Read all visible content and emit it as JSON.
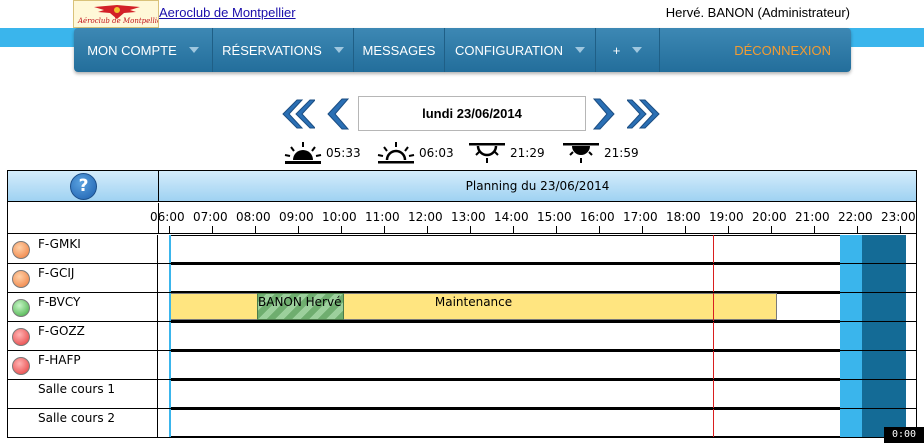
{
  "header": {
    "logo_text": "Aéroclub de Montpellier",
    "club_name": "Aeroclub de Montpellier",
    "user": "Hervé. BANON (Administrateur)"
  },
  "nav": {
    "items": [
      {
        "label": "MON COMPTE",
        "has_caret": true
      },
      {
        "label": "RÉSERVATIONS",
        "has_caret": true
      },
      {
        "label": "MESSAGES",
        "has_caret": false
      },
      {
        "label": "CONFIGURATION",
        "has_caret": true
      },
      {
        "label": "+",
        "has_caret": true
      }
    ],
    "logout": "DÉCONNEXION"
  },
  "date_nav": {
    "current_date": "lundi 23/06/2014",
    "first_icon": "double-chevron-left-icon",
    "prev_icon": "chevron-left-icon",
    "next_icon": "chevron-right-icon",
    "last_icon": "double-chevron-right-icon"
  },
  "sun": {
    "dawn": "05:33",
    "sunrise": "06:03",
    "sunset": "21:29",
    "dusk": "21:59"
  },
  "planning": {
    "help_icon": "help-icon",
    "title": "Planning du 23/06/2014",
    "hours": [
      "06:00",
      "07:00",
      "08:00",
      "09:00",
      "10:00",
      "11:00",
      "12:00",
      "13:00",
      "14:00",
      "15:00",
      "16:00",
      "17:00",
      "18:00",
      "19:00",
      "20:00",
      "21:00",
      "22:00",
      "23:00"
    ],
    "resources": [
      {
        "name": "F-GMKI",
        "status": "orange"
      },
      {
        "name": "F-GCIJ",
        "status": "orange"
      },
      {
        "name": "F-BVCY",
        "status": "green"
      },
      {
        "name": "F-GOZZ",
        "status": "red"
      },
      {
        "name": "F-HAFP",
        "status": "red"
      },
      {
        "name": "Salle cours 1",
        "status": null
      },
      {
        "name": "Salle cours 2",
        "status": null
      }
    ],
    "bookings": {
      "pilot": "BANON Hervé",
      "maintenance": "Maintenance"
    }
  },
  "colors": {
    "top_band": "#3ab5ec",
    "nav_bg": "#2a78a6",
    "logout": "#f39c32",
    "maintenance": "#ffe580",
    "pilot_booking": "#7fbf7f",
    "night_light": "#3ab5ec",
    "night_dark": "#146b96",
    "now_line": "#d91e1e"
  },
  "timer": "0:00"
}
